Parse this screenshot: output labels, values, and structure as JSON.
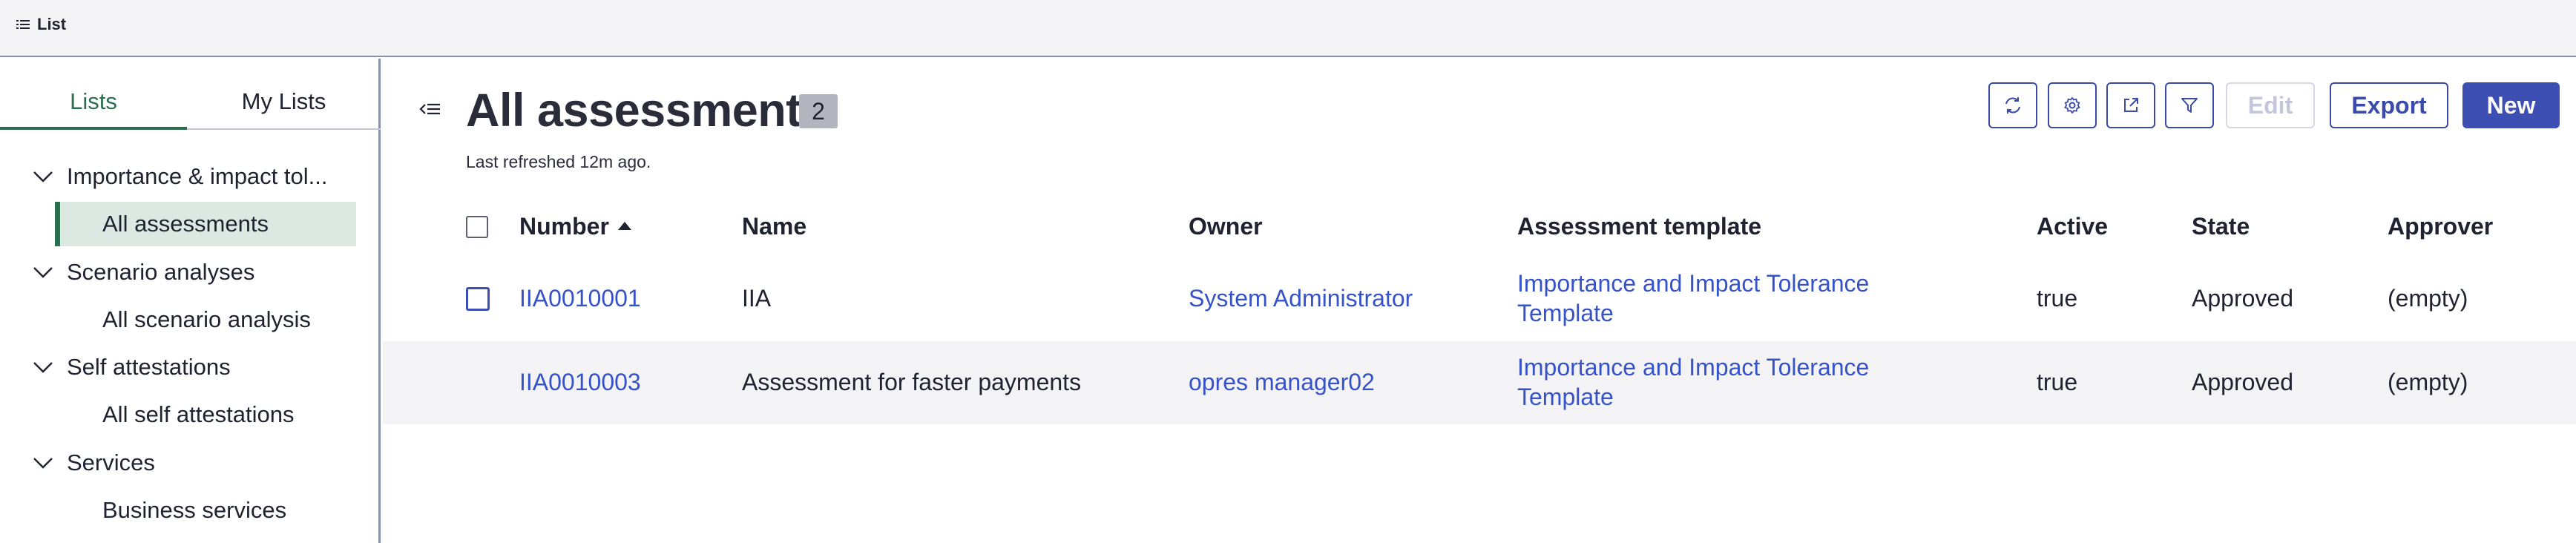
{
  "topbar": {
    "menu_label": "List"
  },
  "sidebar": {
    "tabs": [
      {
        "label": "Lists",
        "active": true
      },
      {
        "label": "My Lists",
        "active": false
      }
    ],
    "tree": [
      {
        "label": "Importance & impact tol...",
        "type": "group",
        "expanded": true
      },
      {
        "label": "All assessments",
        "type": "item",
        "selected": true
      },
      {
        "label": "Scenario analyses",
        "type": "group",
        "expanded": true
      },
      {
        "label": "All scenario analysis",
        "type": "item",
        "selected": false
      },
      {
        "label": "Self attestations",
        "type": "group",
        "expanded": true
      },
      {
        "label": "All self attestations",
        "type": "item",
        "selected": false
      },
      {
        "label": "Services",
        "type": "group",
        "expanded": true
      },
      {
        "label": "Business services",
        "type": "item",
        "selected": false
      }
    ]
  },
  "header": {
    "title": "All assessments",
    "count": "2",
    "refreshed": "Last refreshed 12m ago."
  },
  "toolbar": {
    "icons": [
      "refresh-icon",
      "gear-icon",
      "share-icon",
      "filter-icon"
    ],
    "edit_label": "Edit",
    "export_label": "Export",
    "new_label": "New"
  },
  "table": {
    "columns": [
      "Number",
      "Name",
      "Owner",
      "Assessment template",
      "Active",
      "State",
      "Approver"
    ],
    "sort_column": "Number",
    "rows": [
      {
        "number": "IIA0010001",
        "name": "IIA",
        "owner": "System Administrator",
        "template": "Importance and Impact Tolerance Template",
        "active": "true",
        "state": "Approved",
        "approver": "(empty)"
      },
      {
        "number": "IIA0010003",
        "name": "Assessment for faster payments",
        "owner": "opres manager02",
        "template": "Importance and Impact Tolerance Template",
        "active": "true",
        "state": "Approved",
        "approver": "(empty)"
      }
    ]
  },
  "colors": {
    "accent_green": "#2b6e4f",
    "primary_blue": "#3e4fb4",
    "link_blue": "#3652c8"
  }
}
